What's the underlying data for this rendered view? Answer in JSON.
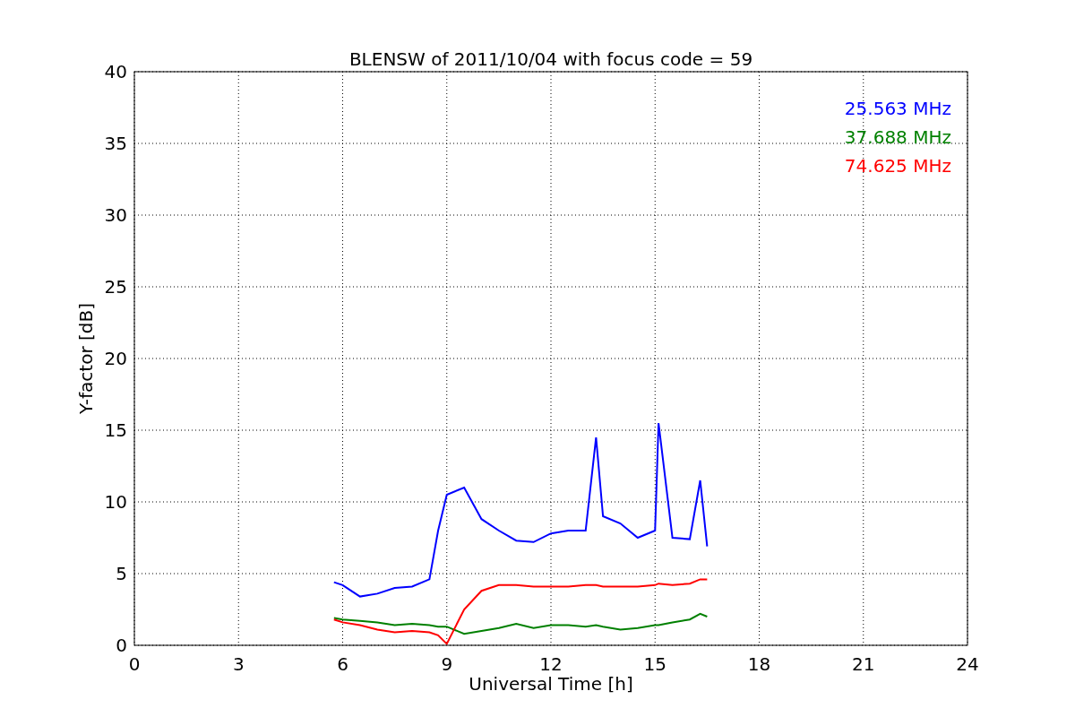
{
  "chart_data": {
    "type": "line",
    "title": "BLENSW of 2011/10/04 with focus code = 59",
    "xlabel": "Universal Time [h]",
    "ylabel": "Y-factor [dB]",
    "x": [
      5.75,
      6,
      6.5,
      7,
      7.5,
      8,
      8.5,
      8.75,
      9,
      9.5,
      10,
      10.5,
      11,
      11.5,
      12,
      12.5,
      13,
      13.3,
      13.5,
      14,
      14.5,
      15,
      15.1,
      15.5,
      16,
      16.3,
      16.5
    ],
    "series": [
      {
        "name": "25.563 MHz",
        "color": "#0000ff",
        "values": [
          4.4,
          4.2,
          3.4,
          3.6,
          4,
          4.1,
          4.6,
          8,
          10.5,
          11,
          8.8,
          8,
          7.3,
          7.2,
          7.8,
          8,
          8,
          14.5,
          9,
          8.5,
          7.5,
          8,
          15.5,
          7.5,
          7.4,
          11.5,
          6.9
        ]
      },
      {
        "name": "37.688 MHz",
        "color": "#008000",
        "values": [
          1.9,
          1.8,
          1.7,
          1.6,
          1.4,
          1.5,
          1.4,
          1.3,
          1.3,
          0.8,
          1.0,
          1.2,
          1.5,
          1.2,
          1.4,
          1.4,
          1.3,
          1.4,
          1.3,
          1.1,
          1.2,
          1.4,
          1.4,
          1.6,
          1.8,
          2.2,
          2.0
        ]
      },
      {
        "name": "74.625 MHz",
        "color": "#ff0000",
        "values": [
          1.8,
          1.6,
          1.4,
          1.1,
          0.9,
          1.0,
          0.9,
          0.7,
          0.1,
          2.5,
          3.8,
          4.2,
          4.2,
          4.1,
          4.1,
          4.1,
          4.2,
          4.2,
          4.1,
          4.1,
          4.1,
          4.2,
          4.3,
          4.2,
          4.3,
          4.6,
          4.6
        ]
      }
    ],
    "xlim": [
      0,
      24
    ],
    "ylim": [
      0,
      40
    ],
    "xticks": [
      0,
      3,
      6,
      9,
      12,
      15,
      18,
      21,
      24
    ],
    "yticks": [
      0,
      5,
      10,
      15,
      20,
      25,
      30,
      35,
      40
    ],
    "grid": true
  }
}
